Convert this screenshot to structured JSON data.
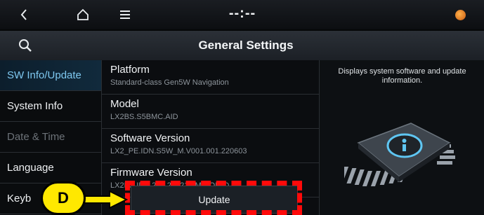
{
  "statusbar": {
    "clock": "--:--",
    "icons": [
      "back-icon",
      "home-icon",
      "menu-icon",
      "notification-icon"
    ]
  },
  "titlebar": {
    "title": "General Settings",
    "search_icon": "search-icon"
  },
  "sidebar": {
    "items": [
      {
        "label": "SW Info/Update",
        "state": "active"
      },
      {
        "label": "System Info",
        "state": "normal"
      },
      {
        "label": "Date & Time",
        "state": "disabled"
      },
      {
        "label": "Language",
        "state": "normal"
      },
      {
        "label": "Keyb",
        "state": "normal"
      }
    ]
  },
  "list": {
    "items": [
      {
        "title": "Platform",
        "subtitle": "Standard-class Gen5W Navigation"
      },
      {
        "title": "Model",
        "subtitle": "LX2BS.S5BMC.AID"
      },
      {
        "title": "Software Version",
        "subtitle": "LX2_PE.IDN.S5W_M.V001.001.220603"
      },
      {
        "title": "Firmware Version",
        "subtitle": "LX2BS.IDN.201.220217.MICOM.D"
      }
    ]
  },
  "info": {
    "description": "Displays system software and update information.",
    "illustration": "chip-info-icon"
  },
  "update_button": {
    "label": "Update"
  },
  "annotation": {
    "label": "D",
    "color": "#ffe800",
    "highlight_color": "#ff0a0a"
  }
}
